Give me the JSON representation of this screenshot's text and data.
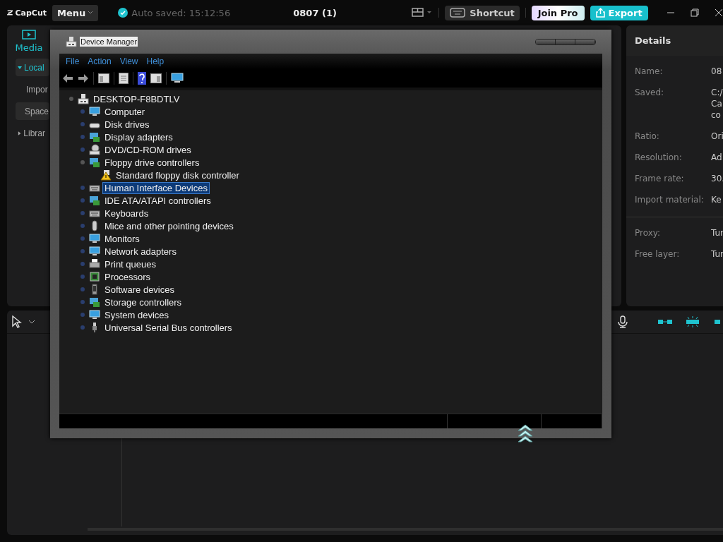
{
  "app": {
    "logo": "CapCut",
    "menu": "Menu",
    "autosave": "Auto saved: 15:12:56",
    "project_title": "0807 (1)",
    "shortcut": "Shortcut",
    "join_pro": "Join Pro",
    "export": "Export"
  },
  "media_panel": {
    "tab": "Media",
    "items": [
      {
        "label": "Local",
        "kind": "folder",
        "expanded": true,
        "selected": true
      },
      {
        "label": "Impor",
        "kind": "link",
        "selected": false
      },
      {
        "label": "Space",
        "kind": "pill",
        "selected": false
      },
      {
        "label": "Librar",
        "kind": "folder",
        "expanded": false,
        "selected": false
      }
    ]
  },
  "details": {
    "title": "Details",
    "sections": [
      [
        {
          "label": "Name:",
          "value": [
            "08"
          ]
        },
        {
          "label": "Saved:",
          "value": [
            "C:/",
            "Ca",
            "co"
          ]
        },
        {
          "label": "Ratio:",
          "value": [
            "Ori"
          ]
        },
        {
          "label": "Resolution:",
          "value": [
            "Ad"
          ]
        },
        {
          "label": "Frame rate:",
          "value": [
            "30."
          ]
        },
        {
          "label": "Import material:",
          "value": [
            "Ke"
          ]
        }
      ],
      [
        {
          "label": "Proxy:",
          "value": [
            "Tur"
          ]
        },
        {
          "label": "Free layer:",
          "value": [
            "Tur"
          ]
        }
      ]
    ]
  },
  "device_manager": {
    "title": "Device Manager",
    "menu": [
      "File",
      "Action",
      "View",
      "Help"
    ],
    "tree": {
      "label": "DESKTOP-F8BDTLV",
      "kind": "pc",
      "expanded": true,
      "selected": false,
      "children": [
        {
          "label": "Computer",
          "kind": "monitor",
          "expanded": false,
          "selected": false
        },
        {
          "label": "Disk drives",
          "kind": "drive",
          "expanded": false,
          "selected": false
        },
        {
          "label": "Display adapters",
          "kind": "card",
          "expanded": false,
          "selected": false
        },
        {
          "label": "DVD/CD-ROM drives",
          "kind": "disc",
          "expanded": false,
          "selected": false
        },
        {
          "label": "Floppy drive controllers",
          "kind": "card",
          "expanded": true,
          "selected": false,
          "children": [
            {
              "label": "Standard floppy disk controller",
              "kind": "warning",
              "selected": false
            }
          ]
        },
        {
          "label": "Human Interface Devices",
          "kind": "keyboard",
          "expanded": false,
          "selected": true
        },
        {
          "label": "IDE ATA/ATAPI controllers",
          "kind": "card",
          "expanded": false,
          "selected": false
        },
        {
          "label": "Keyboards",
          "kind": "keyboard",
          "expanded": false,
          "selected": false
        },
        {
          "label": "Mice and other pointing devices",
          "kind": "mouse",
          "expanded": false,
          "selected": false
        },
        {
          "label": "Monitors",
          "kind": "monitor",
          "expanded": false,
          "selected": false
        },
        {
          "label": "Network adapters",
          "kind": "monitor",
          "expanded": false,
          "selected": false
        },
        {
          "label": "Print queues",
          "kind": "printer",
          "expanded": false,
          "selected": false
        },
        {
          "label": "Processors",
          "kind": "chip",
          "expanded": false,
          "selected": false
        },
        {
          "label": "Software devices",
          "kind": "phone",
          "expanded": false,
          "selected": false
        },
        {
          "label": "Storage controllers",
          "kind": "card",
          "expanded": false,
          "selected": false
        },
        {
          "label": "System devices",
          "kind": "monitor",
          "expanded": false,
          "selected": false
        },
        {
          "label": "Universal Serial Bus controllers",
          "kind": "usb",
          "expanded": false,
          "selected": false
        }
      ]
    }
  }
}
